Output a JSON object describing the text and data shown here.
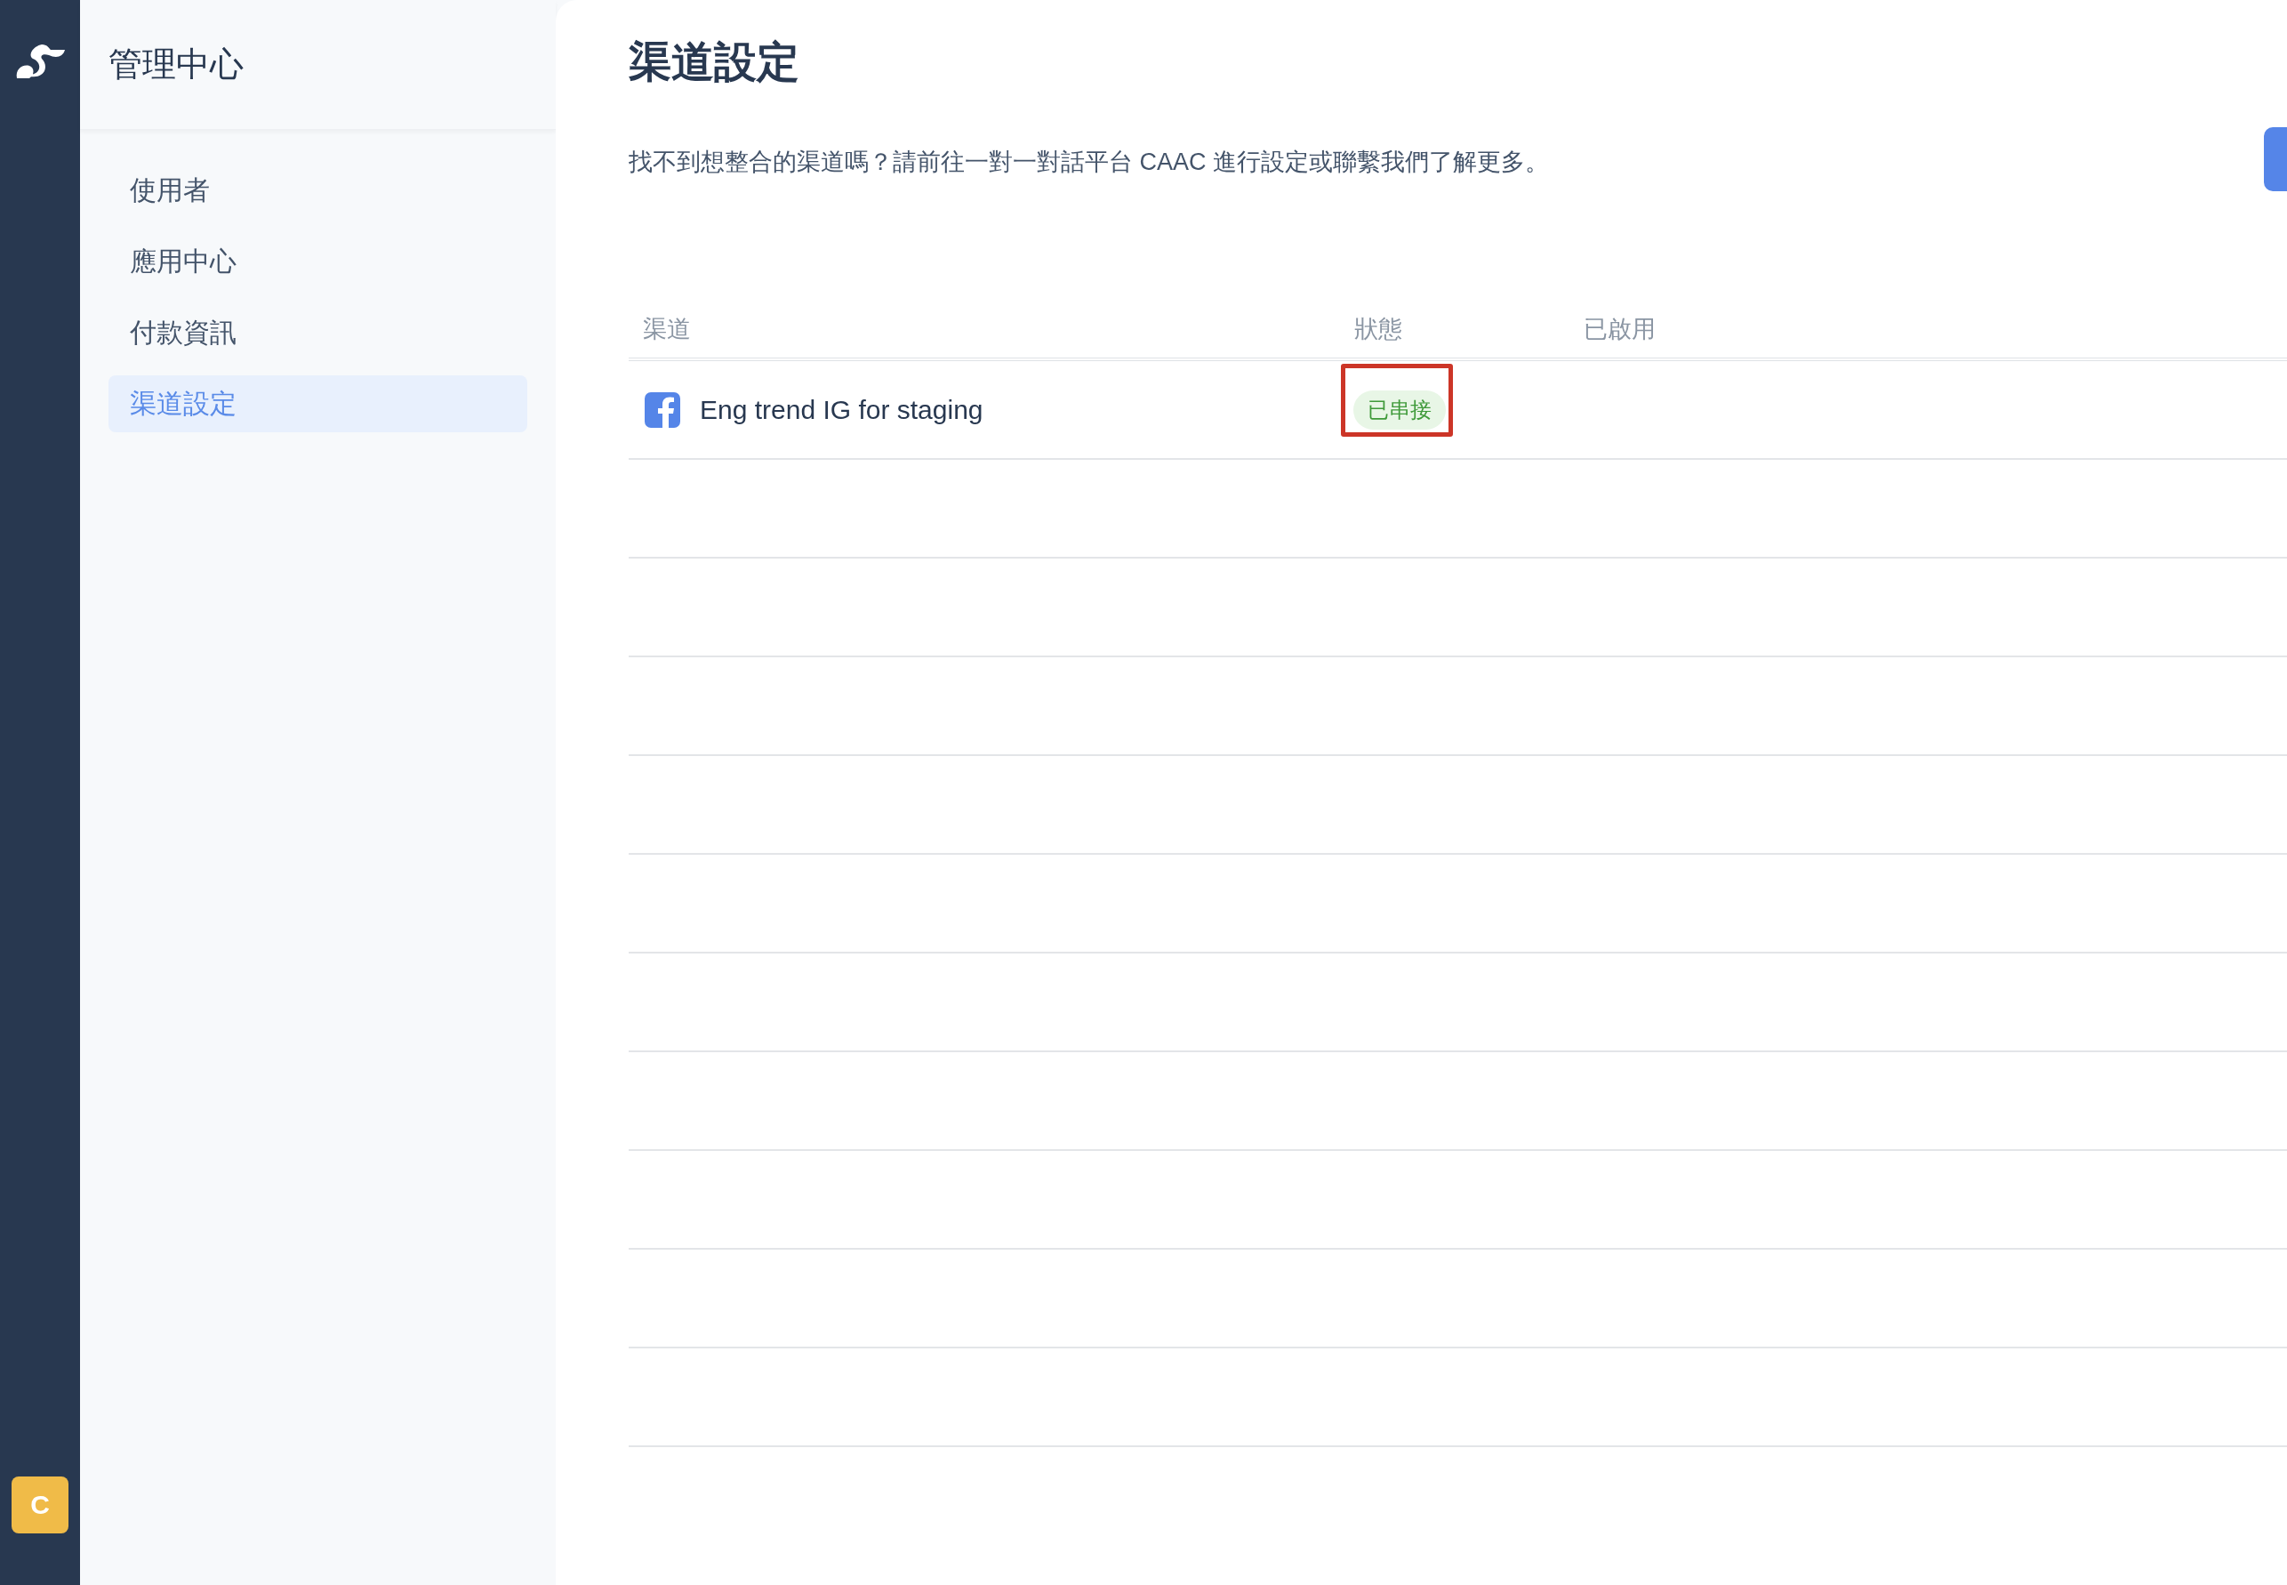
{
  "rail": {
    "avatar": "C"
  },
  "sidebar": {
    "title": "管理中心",
    "items": [
      {
        "label": "使用者",
        "selected": false
      },
      {
        "label": "應用中心",
        "selected": false
      },
      {
        "label": "付款資訊",
        "selected": false
      },
      {
        "label": "渠道設定",
        "selected": true
      }
    ]
  },
  "page": {
    "title": "渠道設定",
    "description": "找不到想整合的渠道嗎？請前往一對一對話平台 CAAC 進行設定或聯繫我們了解更多。"
  },
  "table": {
    "columns": [
      "渠道",
      "狀態",
      "已啟用"
    ],
    "rows": [
      {
        "channel": "Eng trend IG for staging",
        "status": "已串接",
        "highlighted": true
      }
    ]
  }
}
